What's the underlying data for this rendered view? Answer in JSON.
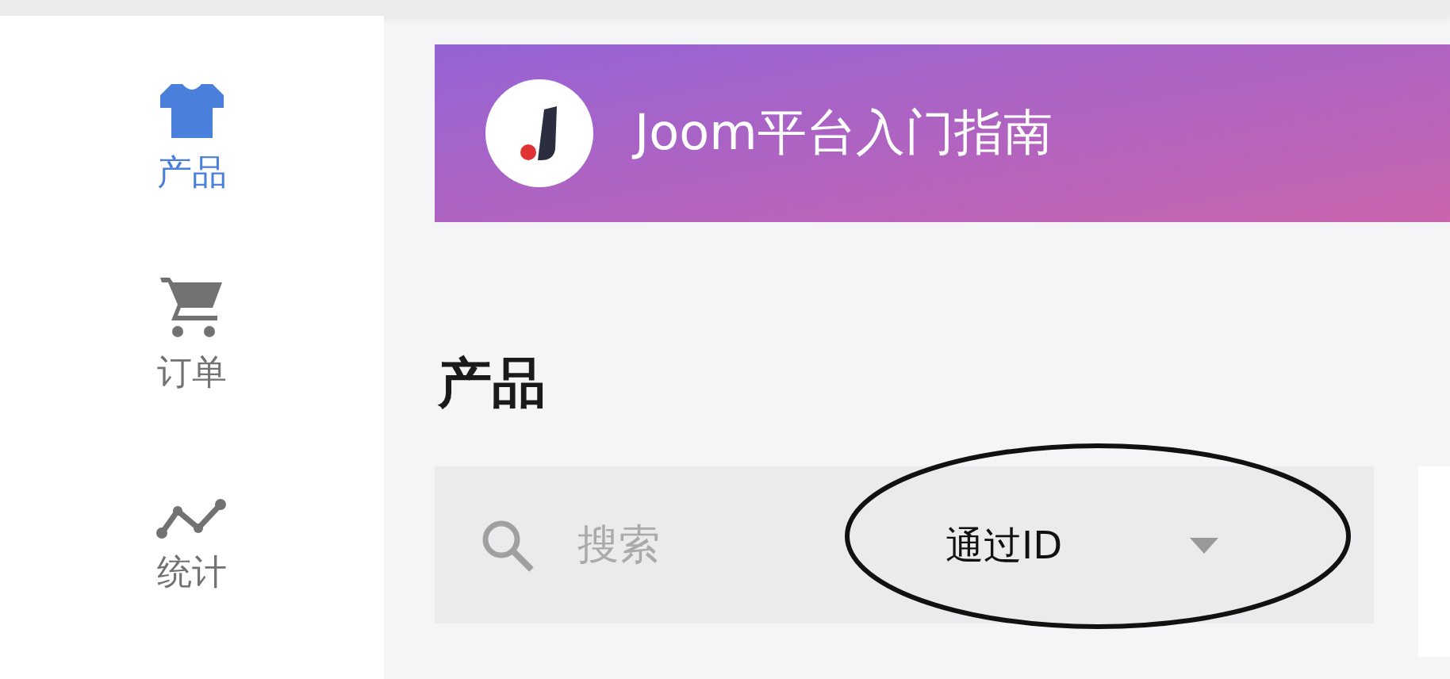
{
  "sidebar": {
    "items": [
      {
        "label": "产品",
        "selected": true
      },
      {
        "label": "订单",
        "selected": false
      },
      {
        "label": "统计",
        "selected": false
      }
    ]
  },
  "banner": {
    "title": "Joom平台入门指南"
  },
  "page_title": "产品",
  "search": {
    "placeholder": "搜索"
  },
  "filter_dropdown": {
    "value": "通过ID"
  },
  "highlight": {
    "kind": "ellipse"
  }
}
